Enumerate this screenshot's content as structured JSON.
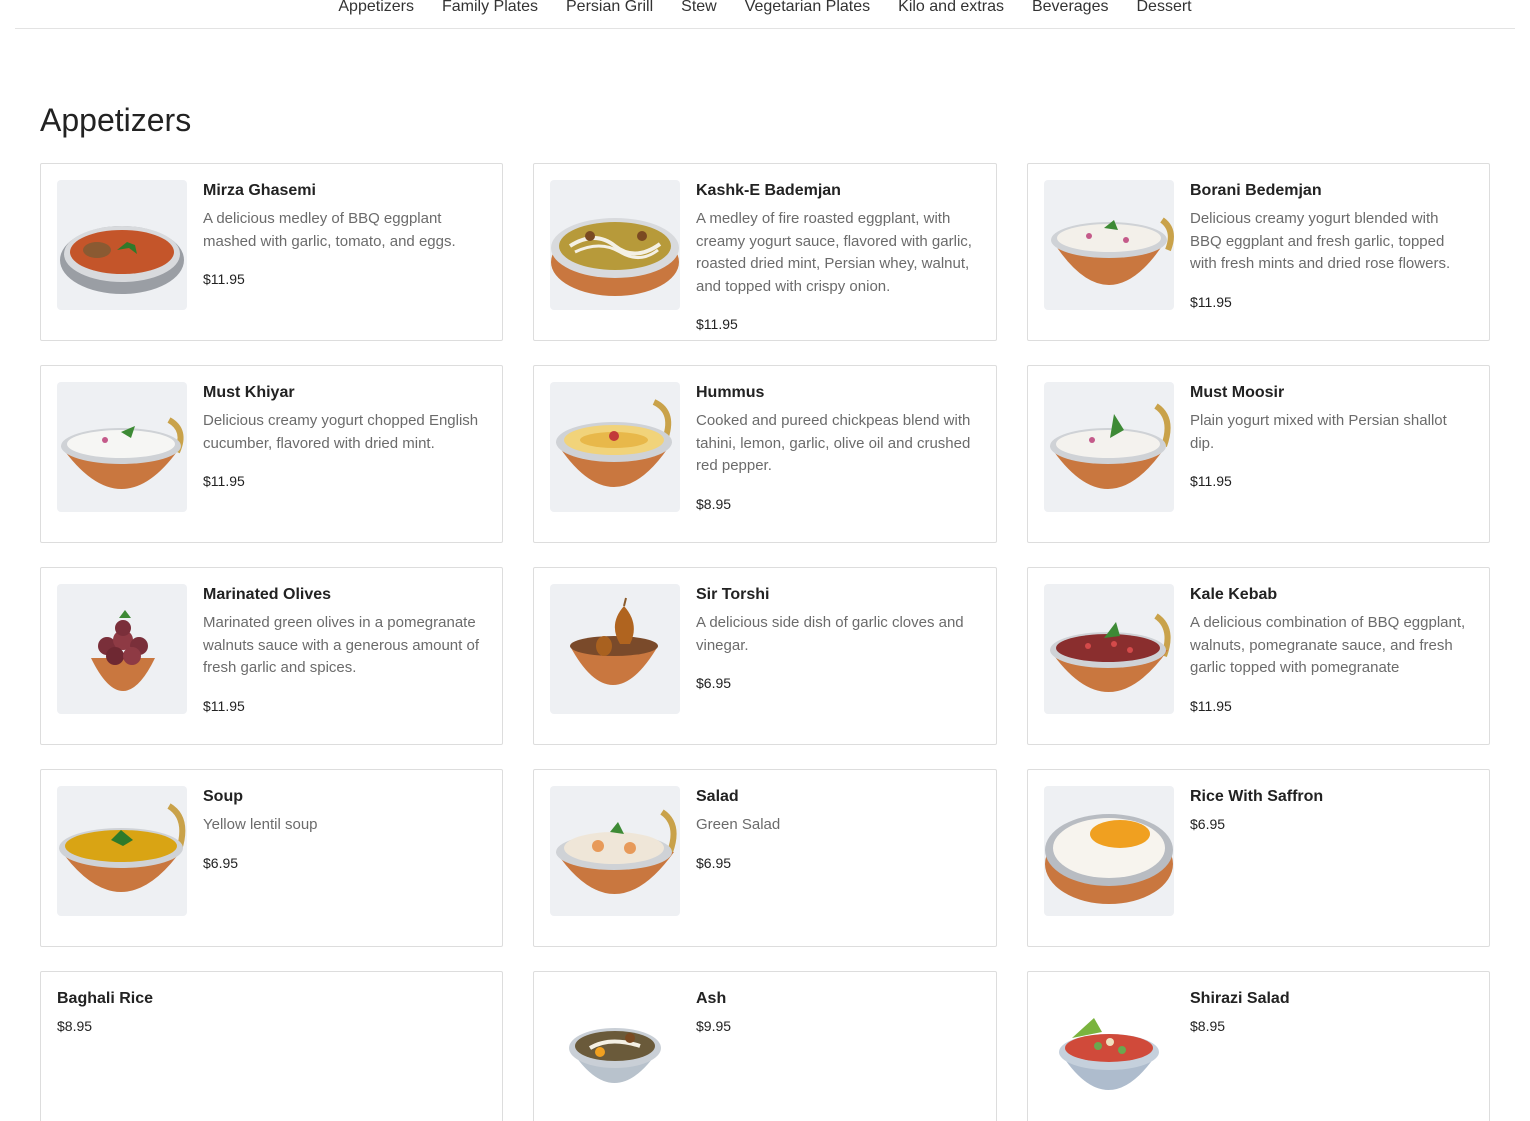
{
  "nav": {
    "items": [
      {
        "label": "Appetizers"
      },
      {
        "label": "Family Plates"
      },
      {
        "label": "Persian Grill"
      },
      {
        "label": "Stew"
      },
      {
        "label": "Vegetarian Plates"
      },
      {
        "label": "Kilo and extras"
      },
      {
        "label": "Beverages"
      },
      {
        "label": "Dessert"
      }
    ]
  },
  "section": {
    "title": "Appetizers"
  },
  "items": [
    {
      "name": "Mirza Ghasemi",
      "description": "A delicious medley of BBQ eggplant mashed with garlic, tomato, and eggs.",
      "price": "$11.95"
    },
    {
      "name": "Kashk-E Bademjan",
      "description": "A medley of fire roasted eggplant, with creamy yogurt sauce, flavored with garlic, roasted dried mint, Persian whey, walnut, and topped with crispy onion.",
      "price": "$11.95"
    },
    {
      "name": "Borani Bedemjan",
      "description": "Delicious creamy yogurt blended with BBQ eggplant and fresh garlic, topped with fresh mints and dried rose flowers.",
      "price": "$11.95"
    },
    {
      "name": "Must Khiyar",
      "description": "Delicious creamy yogurt chopped English cucumber, flavored with dried mint.",
      "price": "$11.95"
    },
    {
      "name": "Hummus",
      "description": "Cooked and pureed chickpeas blend with tahini, lemon, garlic, olive oil and crushed red pepper.",
      "price": "$8.95"
    },
    {
      "name": "Must Moosir",
      "description": "Plain yogurt mixed with Persian shallot dip.",
      "price": "$11.95"
    },
    {
      "name": "Marinated Olives",
      "description": "Marinated green olives in a pomegranate walnuts sauce with a generous amount of fresh garlic and spices.",
      "price": "$11.95"
    },
    {
      "name": "Sir Torshi",
      "description": "A delicious side dish of garlic cloves and vinegar.",
      "price": "$6.95"
    },
    {
      "name": "Kale Kebab",
      "description": "A delicious combination of BBQ eggplant, walnuts, pomegranate sauce, and fresh garlic topped with pomegranate",
      "price": "$11.95"
    },
    {
      "name": "Soup",
      "description": "Yellow lentil soup",
      "price": "$6.95"
    },
    {
      "name": "Salad",
      "description": "Green Salad",
      "price": "$6.95"
    },
    {
      "name": "Rice With Saffron",
      "price": "$6.95"
    },
    {
      "name": "Baghali Rice",
      "price": "$8.95"
    },
    {
      "name": "Ash",
      "price": "$9.95"
    },
    {
      "name": "Shirazi Salad",
      "price": "$8.95"
    }
  ],
  "colors": {
    "copper": "#c9773f",
    "border": "#dddddd",
    "text_muted": "#6b6b6b",
    "text_dark": "#222222"
  }
}
